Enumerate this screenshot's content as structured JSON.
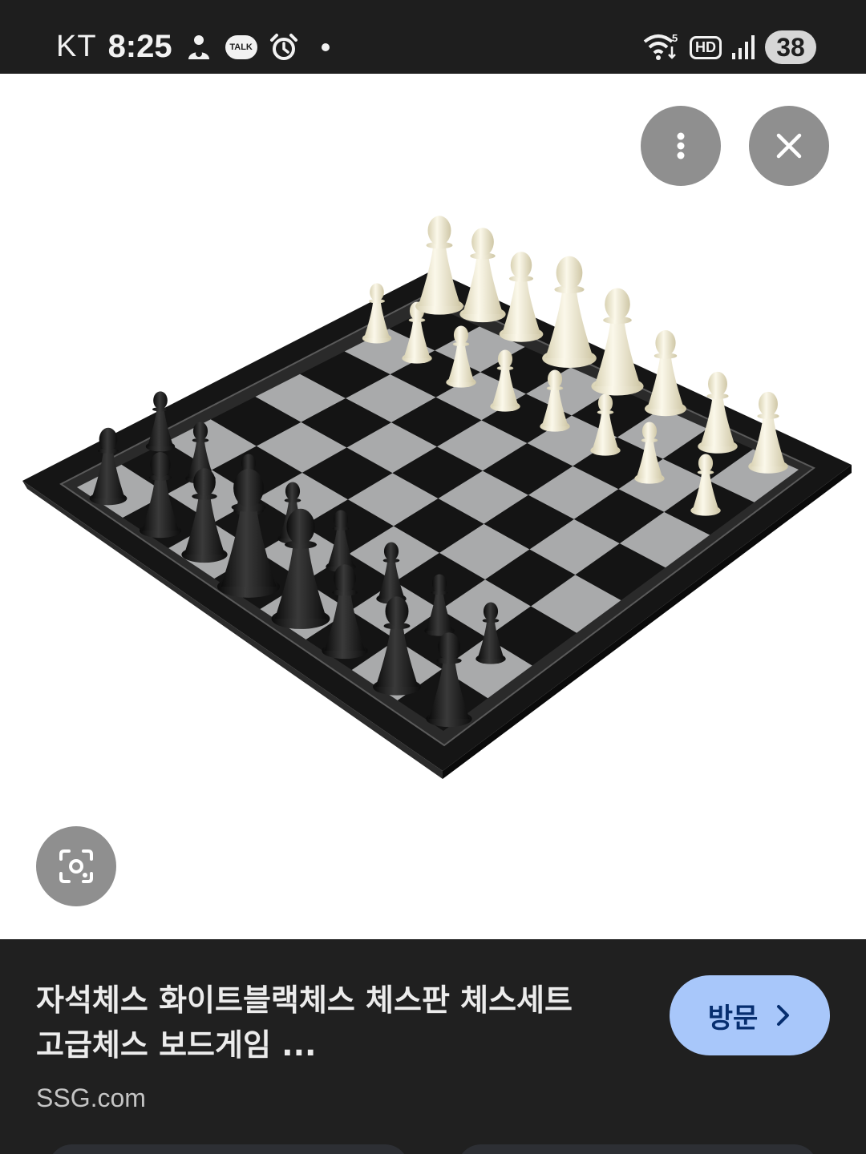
{
  "status_bar": {
    "carrier": "KT",
    "time": "8:25",
    "talk_label": "TALK",
    "network_label": "5",
    "hd_label": "HD",
    "battery": "38"
  },
  "icons": {
    "menu": "more-vert-icon",
    "close": "close-icon",
    "lens": "lens-search-icon",
    "visit_chevron": "chevron-right-icon"
  },
  "result": {
    "title_line1": "자석체스 화이트블랙체스 체스판 체스세트",
    "title_line2": "고급체스 보드게임 ...",
    "source": "SSG.com",
    "visit_label": "방문"
  },
  "colors": {
    "status_bar_bg": "#1e1e1e",
    "panel_bg": "#202020",
    "visit_button_bg": "#a8c7fa",
    "overlay_button_bg": "#8f8f8f"
  }
}
